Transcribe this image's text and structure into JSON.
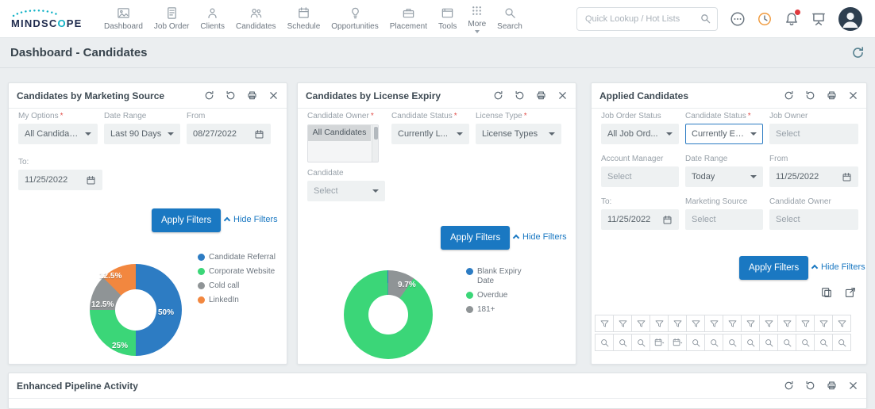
{
  "ui": {
    "required_marker": "*"
  },
  "brand": {
    "name": "MINDSCOPE",
    "parts": [
      "MINDSC",
      "O",
      "PE"
    ],
    "accent_teal": "#12b2c6",
    "navy": "#202c4e"
  },
  "topnav": {
    "items": [
      {
        "label": "Dashboard",
        "icon": "dashboard-icon"
      },
      {
        "label": "Job Order",
        "icon": "job-order-icon"
      },
      {
        "label": "Clients",
        "icon": "clients-icon"
      },
      {
        "label": "Candidates",
        "icon": "candidates-icon"
      },
      {
        "label": "Schedule",
        "icon": "schedule-icon"
      },
      {
        "label": "Opportunities",
        "icon": "opportunities-icon"
      },
      {
        "label": "Placement",
        "icon": "placement-icon"
      },
      {
        "label": "Tools",
        "icon": "tools-icon"
      },
      {
        "label": "More",
        "icon": "more-icon"
      },
      {
        "label": "Search",
        "icon": "search-icon"
      }
    ],
    "quick_lookup_placeholder": "Quick Lookup / Hot Lists"
  },
  "page": {
    "title": "Dashboard - Candidates"
  },
  "colors": {
    "accent_blue": "#1a78c2",
    "badge_red": "#e0393e"
  },
  "widgets": {
    "marketing": {
      "title": "Candidates by Marketing Source",
      "fields": {
        "my_options": {
          "label": "My Options",
          "required": true,
          "value": "All Candidates"
        },
        "date_range": {
          "label": "Date Range",
          "value": "Last 90 Days"
        },
        "from": {
          "label": "From",
          "value": "08/27/2022"
        },
        "to": {
          "label": "To:",
          "value": "11/25/2022"
        }
      },
      "apply_label": "Apply Filters",
      "hide_label": "Hide Filters",
      "chart": {
        "type": "donut",
        "legend_position": "right",
        "labels": [
          "Candidate Referral",
          "Corporate Website",
          "Cold call",
          "LinkedIn"
        ],
        "values": [
          50,
          25,
          12.5,
          12.5
        ],
        "labels_pct": [
          "50%",
          "25%",
          "12.5%",
          "12.5%"
        ],
        "colors": [
          "#2d7cc3",
          "#3bd678",
          "#8f9496",
          "#f2873f"
        ]
      }
    },
    "license": {
      "title": "Candidates by License Expiry",
      "fields": {
        "candidate_owner": {
          "label": "Candidate Owner",
          "required": true,
          "items": [
            "All Candidates"
          ]
        },
        "candidate_status": {
          "label": "Candidate Status",
          "required": true,
          "value": "Currently L..."
        },
        "license_type": {
          "label": "License Type",
          "required": true,
          "value": "License Types"
        },
        "candidate": {
          "label": "Candidate",
          "value": "Select"
        }
      },
      "apply_label": "Apply Filters",
      "hide_label": "Hide Filters",
      "chart": {
        "type": "donut",
        "legend_position": "right",
        "labels": [
          "Blank Expiry Date",
          "Overdue",
          "181+"
        ],
        "values": [
          0.3,
          90,
          9.7
        ],
        "labels_pct": [
          "",
          "",
          "9.7%"
        ],
        "colors": [
          "#2d7cc3",
          "#3bd678",
          "#8f9496"
        ],
        "render_order": [
          2,
          1,
          0
        ]
      }
    },
    "applied": {
      "title": "Applied Candidates",
      "fields": {
        "job_order_status": {
          "label": "Job Order Status",
          "value": "All Job Ord..."
        },
        "candidate_status": {
          "label": "Candidate Status",
          "required": true,
          "value": "Currently Emp",
          "focused": true
        },
        "job_owner": {
          "label": "Job Owner",
          "value": "Select"
        },
        "account_manager": {
          "label": "Account Manager",
          "value": "Select"
        },
        "date_range": {
          "label": "Date Range",
          "value": "Today"
        },
        "from": {
          "label": "From",
          "value": "11/25/2022"
        },
        "to": {
          "label": "To:",
          "value": "11/25/2022"
        },
        "marketing_source": {
          "label": "Marketing Source",
          "value": "Select"
        },
        "candidate_owner": {
          "label": "Candidate Owner",
          "value": "Select"
        }
      },
      "apply_label": "Apply Filters",
      "hide_label": "Hide Filters",
      "grid": {
        "filter_columns": 14,
        "calendar_columns": [
          3,
          4
        ]
      }
    },
    "pipeline": {
      "title": "Enhanced Pipeline Activity"
    }
  }
}
